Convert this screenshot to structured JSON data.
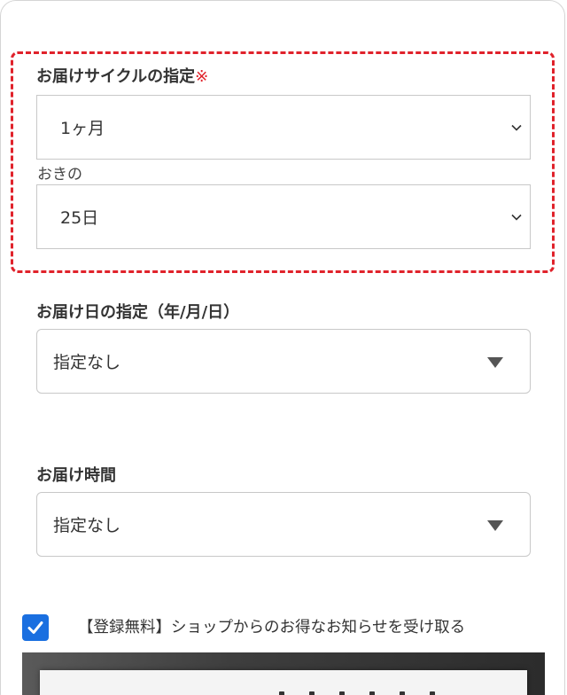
{
  "delivery_cycle": {
    "label": "お届けサイクルの指定",
    "required_mark": "※",
    "interval_value": "1ヶ月",
    "interval_suffix": "おきの",
    "day_value": "25日"
  },
  "delivery_date": {
    "label": "お届け日の指定（年/月/日）",
    "value": "指定なし"
  },
  "delivery_time": {
    "label": "お届け時間",
    "value": "指定なし"
  },
  "newsletter": {
    "label": "【登録無料】ショップからのお得なお知らせを受け取る",
    "checked": true
  },
  "colors": {
    "required_accent": "#e0222b",
    "checkbox": "#1a6fe0"
  },
  "icons": {
    "select_arrow": "chevron-down-icon",
    "dropdown_arrow": "triangle-down-icon",
    "checkbox": "checkmark-icon"
  }
}
